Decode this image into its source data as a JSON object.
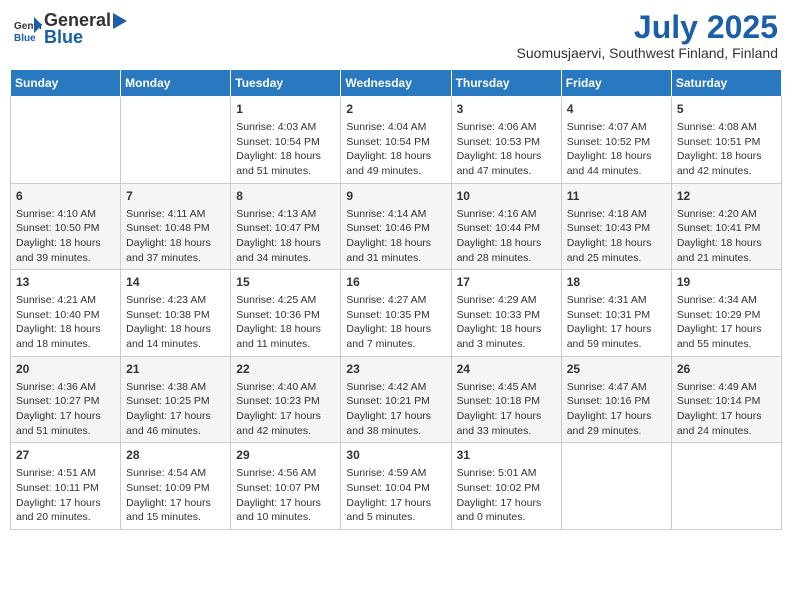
{
  "header": {
    "logo_general": "General",
    "logo_blue": "Blue",
    "month_year": "July 2025",
    "location": "Suomusjaervi, Southwest Finland, Finland"
  },
  "weekdays": [
    "Sunday",
    "Monday",
    "Tuesday",
    "Wednesday",
    "Thursday",
    "Friday",
    "Saturday"
  ],
  "weeks": [
    [
      {
        "day": "",
        "info": ""
      },
      {
        "day": "",
        "info": ""
      },
      {
        "day": "1",
        "info": "Sunrise: 4:03 AM\nSunset: 10:54 PM\nDaylight: 18 hours and 51 minutes."
      },
      {
        "day": "2",
        "info": "Sunrise: 4:04 AM\nSunset: 10:54 PM\nDaylight: 18 hours and 49 minutes."
      },
      {
        "day": "3",
        "info": "Sunrise: 4:06 AM\nSunset: 10:53 PM\nDaylight: 18 hours and 47 minutes."
      },
      {
        "day": "4",
        "info": "Sunrise: 4:07 AM\nSunset: 10:52 PM\nDaylight: 18 hours and 44 minutes."
      },
      {
        "day": "5",
        "info": "Sunrise: 4:08 AM\nSunset: 10:51 PM\nDaylight: 18 hours and 42 minutes."
      }
    ],
    [
      {
        "day": "6",
        "info": "Sunrise: 4:10 AM\nSunset: 10:50 PM\nDaylight: 18 hours and 39 minutes."
      },
      {
        "day": "7",
        "info": "Sunrise: 4:11 AM\nSunset: 10:48 PM\nDaylight: 18 hours and 37 minutes."
      },
      {
        "day": "8",
        "info": "Sunrise: 4:13 AM\nSunset: 10:47 PM\nDaylight: 18 hours and 34 minutes."
      },
      {
        "day": "9",
        "info": "Sunrise: 4:14 AM\nSunset: 10:46 PM\nDaylight: 18 hours and 31 minutes."
      },
      {
        "day": "10",
        "info": "Sunrise: 4:16 AM\nSunset: 10:44 PM\nDaylight: 18 hours and 28 minutes."
      },
      {
        "day": "11",
        "info": "Sunrise: 4:18 AM\nSunset: 10:43 PM\nDaylight: 18 hours and 25 minutes."
      },
      {
        "day": "12",
        "info": "Sunrise: 4:20 AM\nSunset: 10:41 PM\nDaylight: 18 hours and 21 minutes."
      }
    ],
    [
      {
        "day": "13",
        "info": "Sunrise: 4:21 AM\nSunset: 10:40 PM\nDaylight: 18 hours and 18 minutes."
      },
      {
        "day": "14",
        "info": "Sunrise: 4:23 AM\nSunset: 10:38 PM\nDaylight: 18 hours and 14 minutes."
      },
      {
        "day": "15",
        "info": "Sunrise: 4:25 AM\nSunset: 10:36 PM\nDaylight: 18 hours and 11 minutes."
      },
      {
        "day": "16",
        "info": "Sunrise: 4:27 AM\nSunset: 10:35 PM\nDaylight: 18 hours and 7 minutes."
      },
      {
        "day": "17",
        "info": "Sunrise: 4:29 AM\nSunset: 10:33 PM\nDaylight: 18 hours and 3 minutes."
      },
      {
        "day": "18",
        "info": "Sunrise: 4:31 AM\nSunset: 10:31 PM\nDaylight: 17 hours and 59 minutes."
      },
      {
        "day": "19",
        "info": "Sunrise: 4:34 AM\nSunset: 10:29 PM\nDaylight: 17 hours and 55 minutes."
      }
    ],
    [
      {
        "day": "20",
        "info": "Sunrise: 4:36 AM\nSunset: 10:27 PM\nDaylight: 17 hours and 51 minutes."
      },
      {
        "day": "21",
        "info": "Sunrise: 4:38 AM\nSunset: 10:25 PM\nDaylight: 17 hours and 46 minutes."
      },
      {
        "day": "22",
        "info": "Sunrise: 4:40 AM\nSunset: 10:23 PM\nDaylight: 17 hours and 42 minutes."
      },
      {
        "day": "23",
        "info": "Sunrise: 4:42 AM\nSunset: 10:21 PM\nDaylight: 17 hours and 38 minutes."
      },
      {
        "day": "24",
        "info": "Sunrise: 4:45 AM\nSunset: 10:18 PM\nDaylight: 17 hours and 33 minutes."
      },
      {
        "day": "25",
        "info": "Sunrise: 4:47 AM\nSunset: 10:16 PM\nDaylight: 17 hours and 29 minutes."
      },
      {
        "day": "26",
        "info": "Sunrise: 4:49 AM\nSunset: 10:14 PM\nDaylight: 17 hours and 24 minutes."
      }
    ],
    [
      {
        "day": "27",
        "info": "Sunrise: 4:51 AM\nSunset: 10:11 PM\nDaylight: 17 hours and 20 minutes."
      },
      {
        "day": "28",
        "info": "Sunrise: 4:54 AM\nSunset: 10:09 PM\nDaylight: 17 hours and 15 minutes."
      },
      {
        "day": "29",
        "info": "Sunrise: 4:56 AM\nSunset: 10:07 PM\nDaylight: 17 hours and 10 minutes."
      },
      {
        "day": "30",
        "info": "Sunrise: 4:59 AM\nSunset: 10:04 PM\nDaylight: 17 hours and 5 minutes."
      },
      {
        "day": "31",
        "info": "Sunrise: 5:01 AM\nSunset: 10:02 PM\nDaylight: 17 hours and 0 minutes."
      },
      {
        "day": "",
        "info": ""
      },
      {
        "day": "",
        "info": ""
      }
    ]
  ]
}
